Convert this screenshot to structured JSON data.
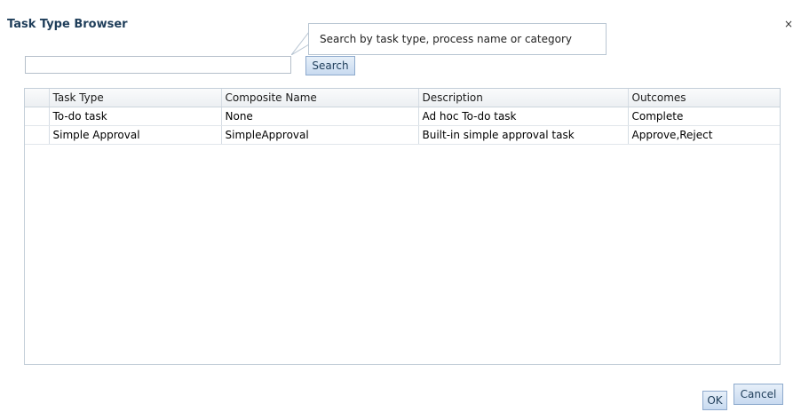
{
  "dialog": {
    "title": "Task Type Browser",
    "close_glyph": "×"
  },
  "search": {
    "tooltip": "Search by task type, process name or category",
    "value": "",
    "button_label": "Search"
  },
  "table": {
    "columns": [
      "Task Type",
      "Composite Name",
      "Description",
      "Outcomes"
    ],
    "rows": [
      [
        "To-do task",
        "None",
        "Ad hoc To-do task",
        "Complete"
      ],
      [
        "Simple Approval",
        "SimpleApproval",
        "Built-in simple approval task",
        "Approve,Reject"
      ]
    ]
  },
  "footer": {
    "ok_label": "OK",
    "cancel_label": "Cancel"
  },
  "colors": {
    "title": "#1f3e5a",
    "button_border": "#8eaacd",
    "grid_border": "#c4cfd9"
  }
}
